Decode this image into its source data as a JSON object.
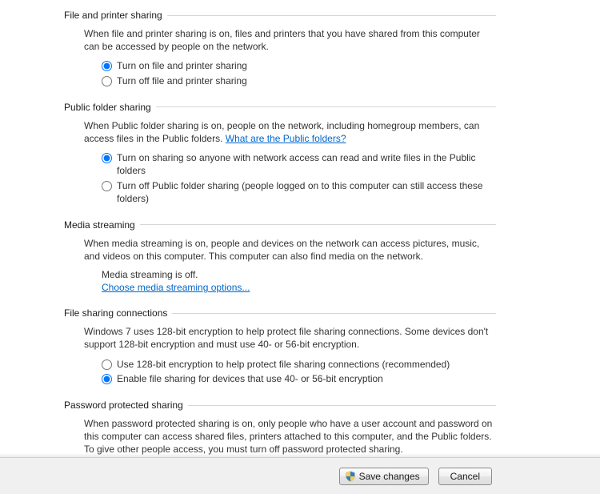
{
  "sections": {
    "filePrinter": {
      "title": "File and printer sharing",
      "desc": "When file and printer sharing is on, files and printers that you have shared from this computer can be accessed by people on the network.",
      "opt_on": "Turn on file and printer sharing",
      "opt_off": "Turn off file and printer sharing"
    },
    "publicFolder": {
      "title": "Public folder sharing",
      "desc_prefix": "When Public folder sharing is on, people on the network, including homegroup members, can access files in the Public folders. ",
      "link": "What are the Public folders?",
      "opt_on": "Turn on sharing so anyone with network access can read and write files in the Public folders",
      "opt_off": "Turn off Public folder sharing (people logged on to this computer can still access these folders)"
    },
    "media": {
      "title": "Media streaming",
      "desc": "When media streaming is on, people and devices on the network can access pictures, music, and videos on this computer. This computer can also find media on the network.",
      "status": "Media streaming is off.",
      "link": "Choose media streaming options..."
    },
    "fileConn": {
      "title": "File sharing connections",
      "desc": "Windows 7 uses 128-bit encryption to help protect file sharing connections. Some devices don't support 128-bit encryption and must use 40- or 56-bit encryption.",
      "opt_128": "Use 128-bit encryption to help protect file sharing connections (recommended)",
      "opt_4056": "Enable file sharing for devices that use 40- or 56-bit encryption"
    },
    "password": {
      "title": "Password protected sharing",
      "desc": "When password protected sharing is on, only people who have a user account and password on this computer can access shared files, printers attached to this computer, and the Public folders. To give other people access, you must turn off password protected sharing."
    }
  },
  "buttons": {
    "save": "Save changes",
    "cancel": "Cancel"
  }
}
